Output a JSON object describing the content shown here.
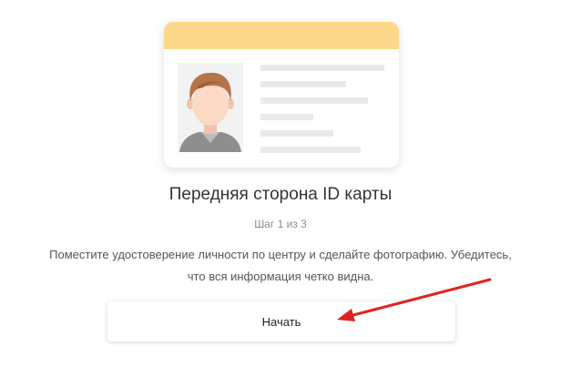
{
  "card": {
    "header_color": "#fcd98a",
    "icon": "id-card-illustration"
  },
  "document": {
    "title": "Передняя сторона ID карты",
    "step": "Шаг 1 из 3",
    "instructions": "Поместите удостоверение личности по центру и сделайте фотографию. Убедитесь,\nчто вся информация четко видна."
  },
  "actions": {
    "start_label": "Начать"
  },
  "annotation": {
    "arrow_color": "#e02424",
    "icon": "red-arrow-annotation"
  }
}
